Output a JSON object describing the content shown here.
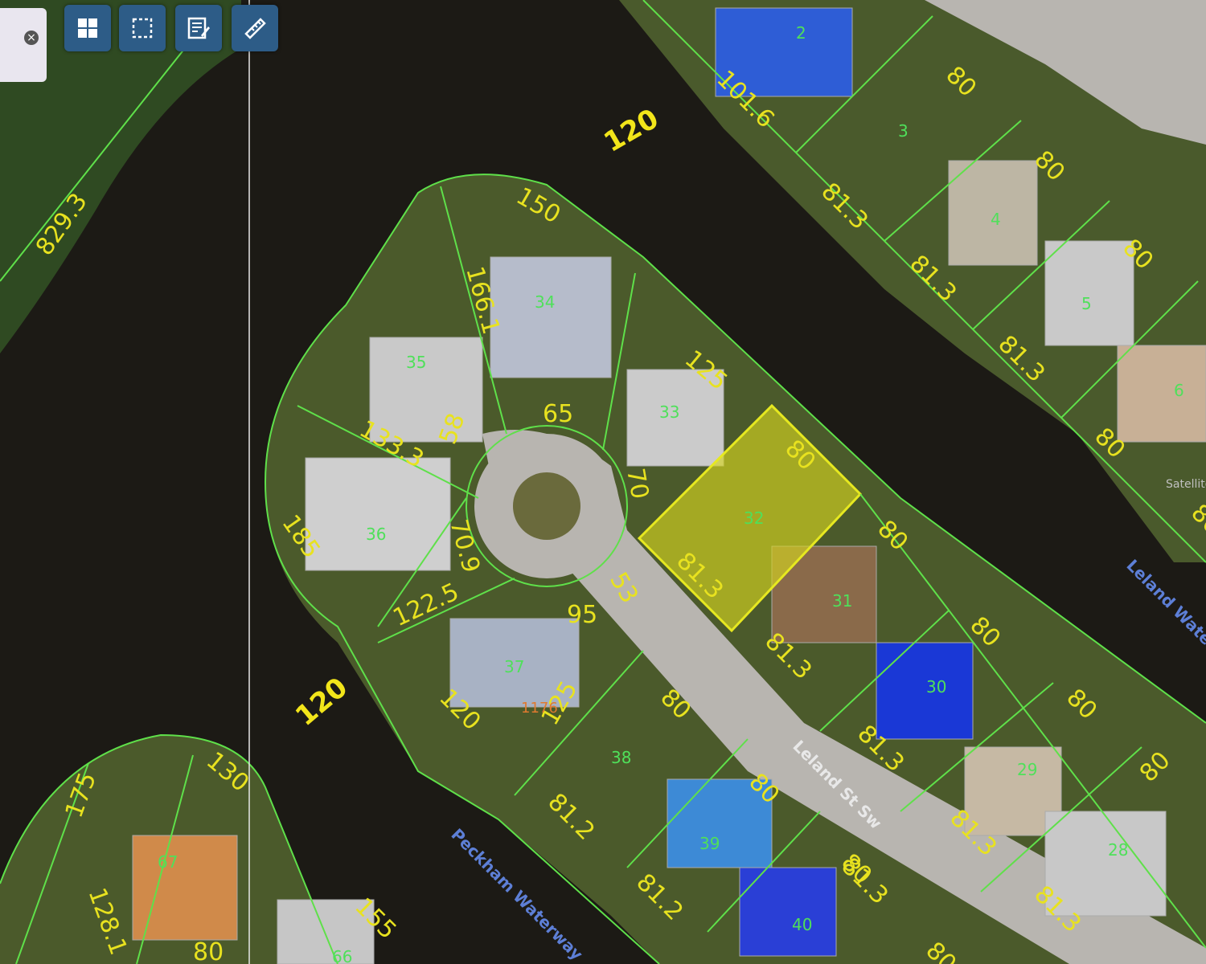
{
  "toolbar": {
    "search_value": "",
    "clear_icon": "close-icon",
    "tools": [
      {
        "name": "grid-icon"
      },
      {
        "name": "select-box-icon"
      },
      {
        "name": "edit-note-icon"
      },
      {
        "name": "ruler-icon"
      }
    ]
  },
  "map": {
    "dimensions": [
      {
        "text": "829.3"
      },
      {
        "text": "120"
      },
      {
        "text": "150"
      },
      {
        "text": "166.1"
      },
      {
        "text": "125"
      },
      {
        "text": "133.3"
      },
      {
        "text": "65"
      },
      {
        "text": "58"
      },
      {
        "text": "70"
      },
      {
        "text": "80"
      },
      {
        "text": "81.3"
      },
      {
        "text": "185"
      },
      {
        "text": "70.9"
      },
      {
        "text": "122.5"
      },
      {
        "text": "95"
      },
      {
        "text": "53"
      },
      {
        "text": "80"
      },
      {
        "text": "81.3"
      },
      {
        "text": "80"
      },
      {
        "text": "120"
      },
      {
        "text": "125"
      },
      {
        "text": "80"
      },
      {
        "text": "81.3"
      },
      {
        "text": "80"
      },
      {
        "text": "81.3"
      },
      {
        "text": "120"
      },
      {
        "text": "130"
      },
      {
        "text": "175"
      },
      {
        "text": "128.1"
      },
      {
        "text": "155"
      },
      {
        "text": "81.2"
      },
      {
        "text": "81.2"
      },
      {
        "text": "80"
      },
      {
        "text": "80"
      },
      {
        "text": "80"
      },
      {
        "text": "81.3"
      },
      {
        "text": "80"
      },
      {
        "text": "81.3"
      },
      {
        "text": "80"
      },
      {
        "text": "101.6"
      },
      {
        "text": "80"
      },
      {
        "text": "81.3"
      },
      {
        "text": "80"
      },
      {
        "text": "81.3"
      },
      {
        "text": "80"
      },
      {
        "text": "80"
      },
      {
        "text": "80"
      },
      {
        "text": "81.3"
      },
      {
        "text": "80"
      },
      {
        "text": "80"
      },
      {
        "text": "80"
      }
    ],
    "lots": [
      "2",
      "3",
      "4",
      "5",
      "6",
      "34",
      "35",
      "33",
      "32",
      "36",
      "31",
      "30",
      "37",
      "38",
      "29",
      "28",
      "39",
      "40",
      "67",
      "66"
    ],
    "address": "1176",
    "street_name": "Leland St Sw",
    "water_labels": [
      "Peckham Waterway",
      "Leland Wate"
    ],
    "copyright": "Satellite",
    "highlight_color": "#d4d41e",
    "parcel_line_color": "#5fe04a",
    "dimension_color": "#e8e21f"
  }
}
